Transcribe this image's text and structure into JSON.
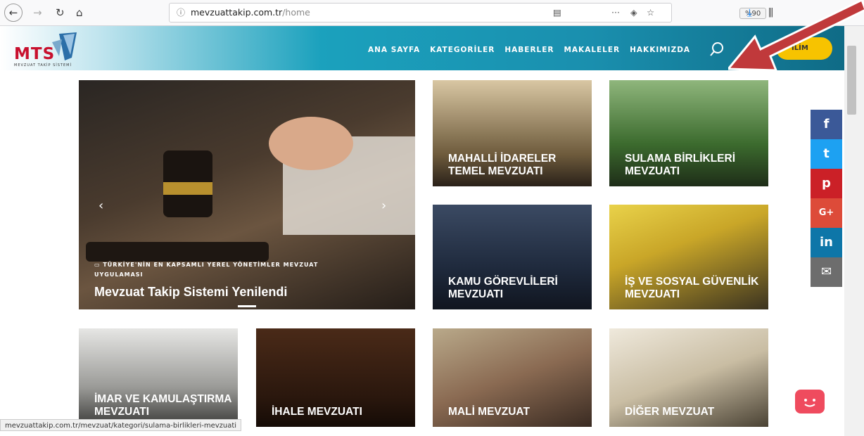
{
  "browser": {
    "url_host": "mevzuattakip.com.tr",
    "url_path": "/home",
    "zoom": "%90"
  },
  "header": {
    "logo": "MTS",
    "logo_sub": "MEVZUAT TAKİP SİSTEMİ",
    "menu": [
      "ANA SAYFA",
      "KATEGORİLER",
      "HABERLER",
      "MAKALELER",
      "HAKKIMIZDA"
    ],
    "login": "İLİM"
  },
  "hero": {
    "meta": "TÜRKİYE'NİN EN KAPSAMLI YEREL YÖNETİMLER MEVZUAT UYGULAMASI",
    "title": "Mevzuat Takip Sistemi Yenilendi"
  },
  "tiles": [
    "MAHALLİ İDARELER TEMEL MEVZUATI",
    "SULAMA BİRLİKLERİ MEVZUATI",
    "KAMU GÖREVLİLERİ MEVZUATI",
    "İŞ VE SOSYAL GÜVENLİK MEVZUATI",
    "İMAR VE KAMULAŞTIRMA MEVZUATI",
    "İHALE MEVZUATI",
    "MALİ MEVZUAT",
    "DİĞER MEVZUAT"
  ],
  "social": [
    "f",
    "t",
    "p",
    "G+",
    "in",
    "✉"
  ],
  "status": "mevzuattakip.com.tr/mevzuat/kategori/sulama-birlikleri-mevzuati",
  "colors": {
    "accent": "#1ba1bd",
    "login": "#f7c300",
    "brand": "#c8102e"
  }
}
